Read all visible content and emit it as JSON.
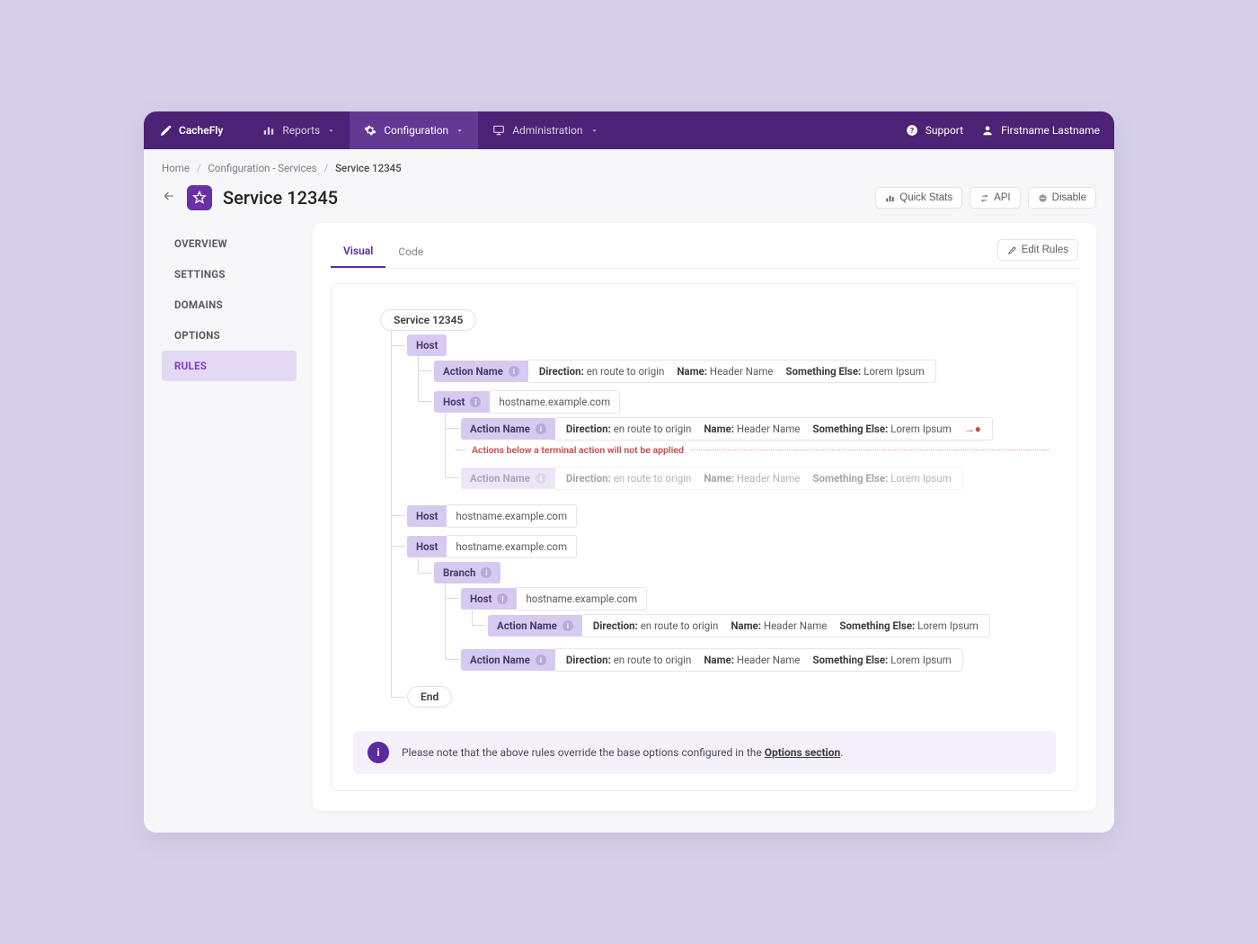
{
  "brand": {
    "name": "CacheFly"
  },
  "nav": {
    "reports": "Reports",
    "configuration": "Configuration",
    "administration": "Administration",
    "support": "Support",
    "user": "Firstname Lastname"
  },
  "breadcrumb": {
    "home": "Home",
    "config": "Configuration - Services",
    "current": "Service 12345"
  },
  "page": {
    "title": "Service 12345",
    "actions": {
      "quick_stats": "Quick Stats",
      "api": "API",
      "disable": "Disable"
    }
  },
  "sidenav": {
    "overview": "OVERVIEW",
    "settings": "SETTINGS",
    "domains": "DOMAINS",
    "options": "OPTIONS",
    "rules": "RULES"
  },
  "tabs": {
    "visual": "Visual",
    "code": "Code",
    "edit_rules": "Edit Rules"
  },
  "rules": {
    "service_label": "Service 12345",
    "host_label": "Host",
    "action_label": "Action Name",
    "branch_label": "Branch",
    "end_label": "End",
    "hostname": "hostname.example.com",
    "kv": {
      "direction_key": "Direction:",
      "direction_val": "en route to origin",
      "name_key": "Name:",
      "name_val": "Header Name",
      "other_key": "Something Else:",
      "other_val": "Lorem Ipsum"
    },
    "terminal_warning": "Actions below a terminal action will not be applied"
  },
  "note": {
    "text_prefix": "Please note that the above rules override the base options configured in the ",
    "link": "Options section",
    "text_suffix": "."
  }
}
